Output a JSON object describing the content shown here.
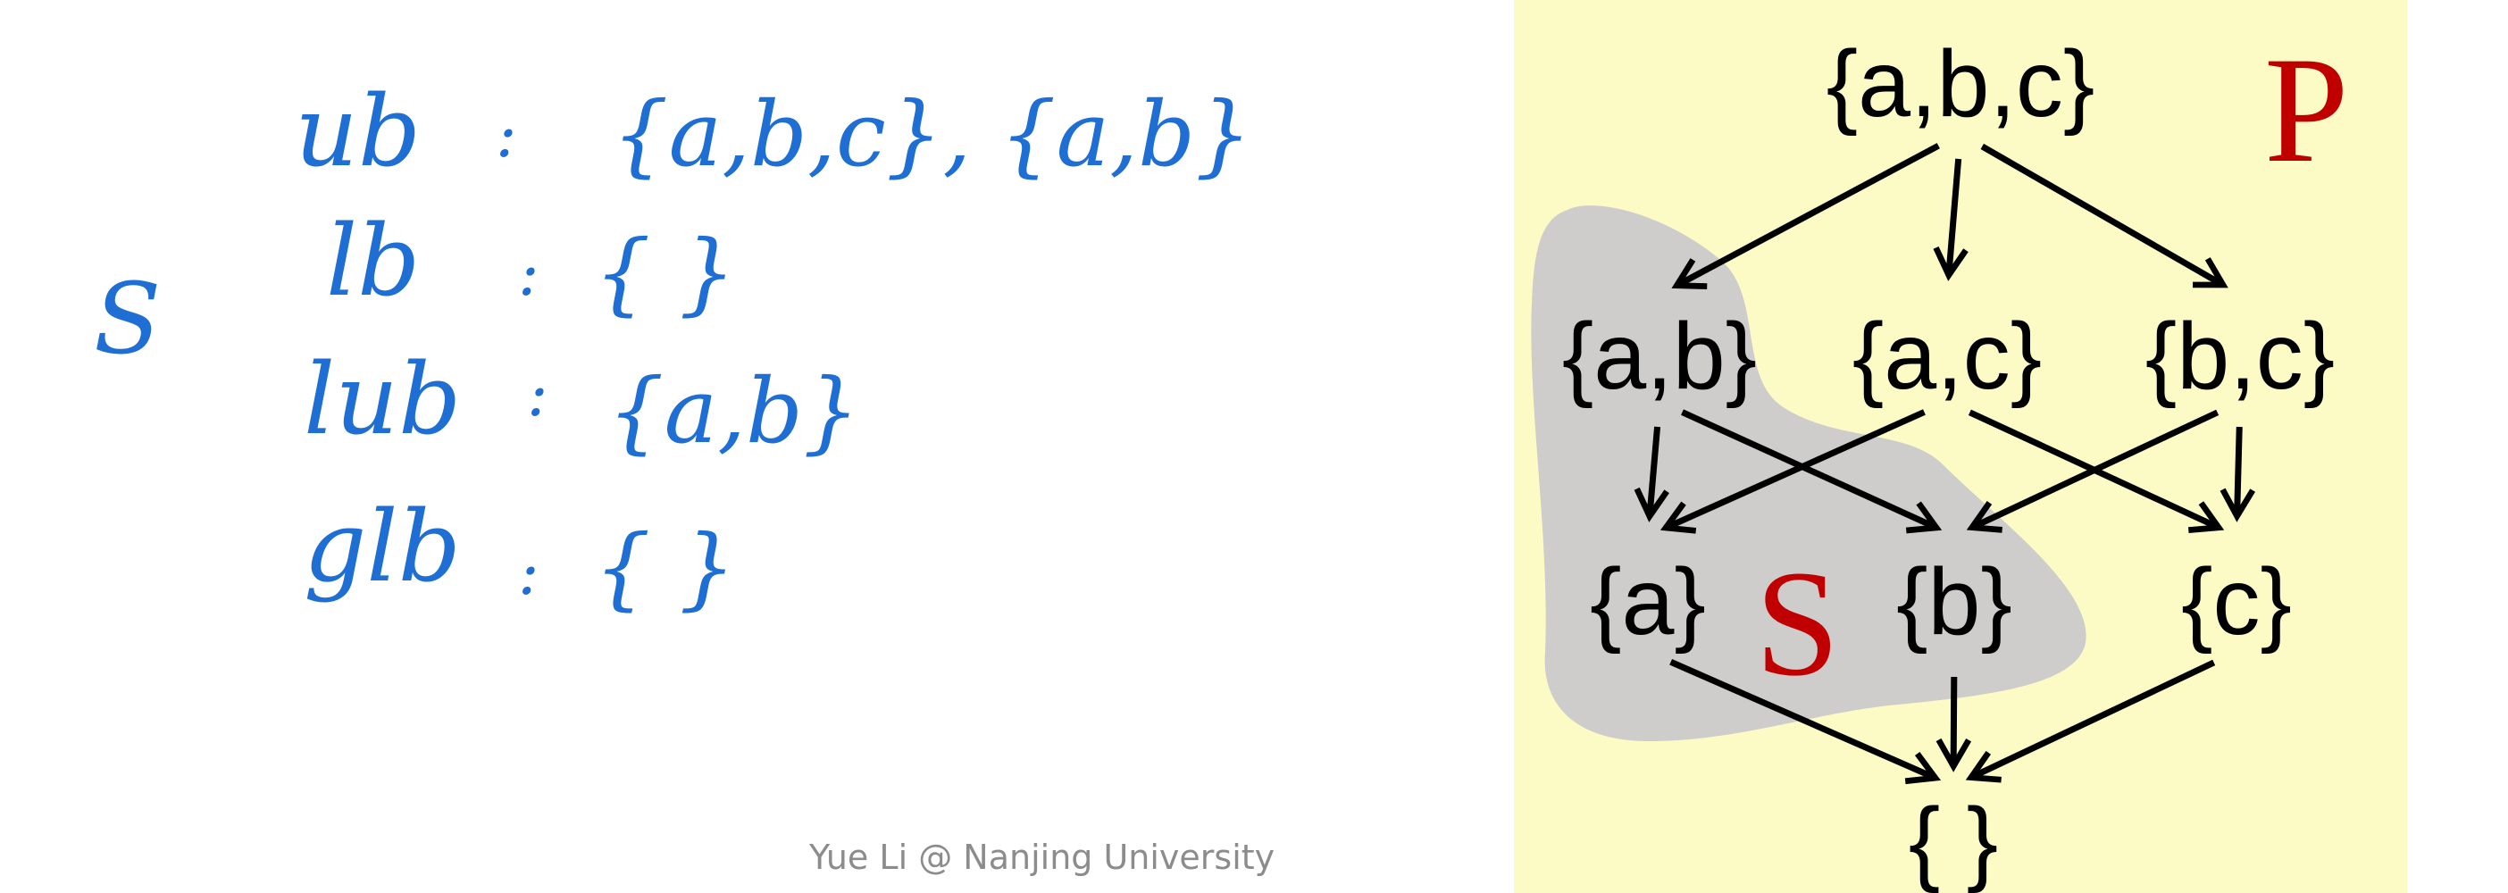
{
  "notes": {
    "set_label": "S",
    "lines": [
      {
        "key": "ub",
        "sep": ":",
        "value": "{a,b,c}, {a,b}"
      },
      {
        "key": "lb",
        "sep": ":",
        "value": "{ }"
      },
      {
        "key": "lub",
        "sep": ":",
        "value": "{a,b}"
      },
      {
        "key": "glb",
        "sep": ":",
        "value": "{ }"
      }
    ]
  },
  "diagram": {
    "poset_label": "P",
    "subset_label": "S",
    "nodes": {
      "abc": "{a,b,c}",
      "ab": "{a,b}",
      "ac": "{a,c}",
      "bc": "{b,c}",
      "a": "{a}",
      "b": "{b}",
      "c": "{c}",
      "empty": "{ }"
    },
    "edges": [
      [
        "abc",
        "ab"
      ],
      [
        "abc",
        "ac"
      ],
      [
        "abc",
        "bc"
      ],
      [
        "ab",
        "a"
      ],
      [
        "ab",
        "b"
      ],
      [
        "ac",
        "a"
      ],
      [
        "ac",
        "c"
      ],
      [
        "bc",
        "b"
      ],
      [
        "bc",
        "c"
      ],
      [
        "a",
        "empty"
      ],
      [
        "b",
        "empty"
      ],
      [
        "c",
        "empty"
      ]
    ],
    "colors": {
      "panel": "#fdfbc5",
      "subset_region": "#cfcccc",
      "letters": "#c00000"
    }
  },
  "footer": "Yue Li @ Nanjing University"
}
